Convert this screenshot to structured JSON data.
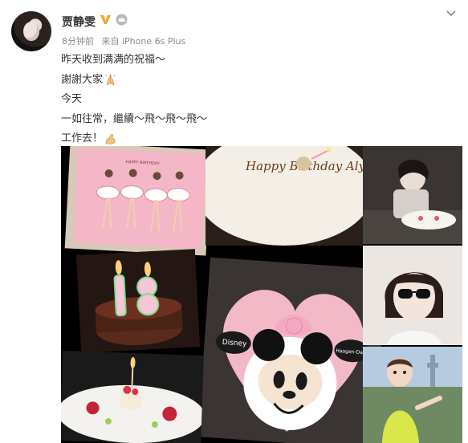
{
  "user": {
    "name": "贾静雯",
    "avatar_icon": "profile-avatar"
  },
  "meta": {
    "time": "8分钟前",
    "source": "来自 iPhone 6s Plus"
  },
  "post": {
    "lines": [
      "昨天收到满满的祝福～",
      "謝謝大家",
      "今天",
      "一如往常，繼續～飛～飛～飛～",
      "工作去！"
    ]
  },
  "photos": {
    "ballet_card": "HAPPY BIRTHDAY",
    "birthday_plate": "Happy Birthday Alyssa",
    "cake_badge_left": "Disney",
    "cake_badge_right": "Haagen-Dazs"
  },
  "colors": {
    "vip": "#f5a623",
    "accent_pink": "#f2b9c6"
  }
}
